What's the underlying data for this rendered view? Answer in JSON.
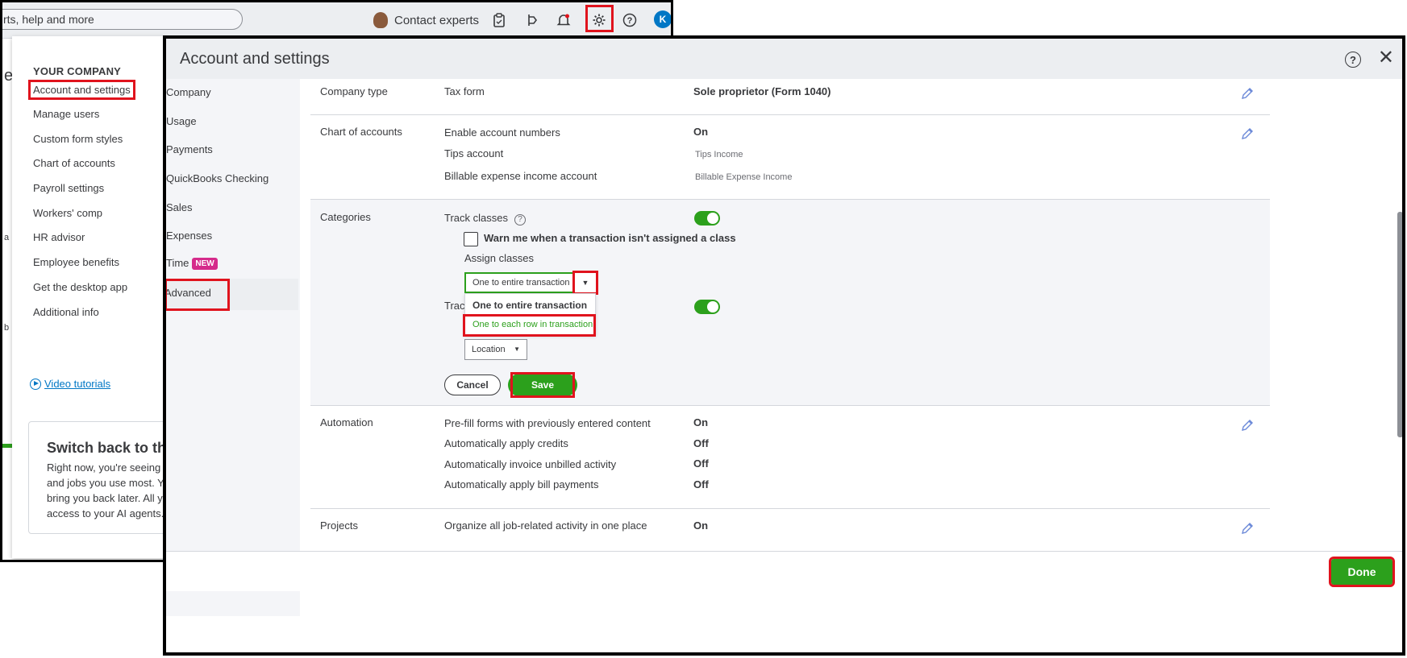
{
  "topbar": {
    "search_text": "rts, help and more",
    "contact_label": "Contact experts",
    "avatar_initial": "K"
  },
  "gear_panel": {
    "heading": "YOUR COMPANY",
    "links": [
      "Account and settings",
      "Manage users",
      "Custom form styles",
      "Chart of accounts",
      "Payroll settings",
      "Workers' comp",
      "HR advisor",
      "Employee benefits",
      "Get the desktop app",
      "Additional info"
    ],
    "video_link": "Video tutorials",
    "switch_title": "Switch back to th",
    "switch_text": [
      "Right now, you're seeing t",
      "and jobs you use most. Yo",
      "bring you back later. All y",
      "access to your AI agents."
    ]
  },
  "dialog": {
    "title": "Account and settings",
    "done_label": "Done"
  },
  "nav": {
    "items": [
      "Company",
      "Usage",
      "Payments",
      "QuickBooks Checking",
      "Sales",
      "Expenses",
      "Time",
      "Advanced"
    ],
    "time_badge": "NEW"
  },
  "sections": {
    "company_type": {
      "label": "Company type",
      "field": "Tax form",
      "value": "Sole proprietor (Form 1040)"
    },
    "chart_of_accounts": {
      "label": "Chart of accounts",
      "rows": [
        {
          "field": "Enable account numbers",
          "value": "On"
        },
        {
          "field": "Tips account",
          "value": "Tips Income"
        },
        {
          "field": "Billable expense income account",
          "value": "Billable Expense Income"
        }
      ]
    },
    "categories": {
      "label": "Categories",
      "track_classes": "Track classes",
      "warn_label": "Warn me when a transaction isn't assigned a class",
      "assign_label": "Assign classes",
      "assign_selected": "One to entire transaction",
      "dropdown_options": [
        "One to entire transaction",
        "One to each row in transaction"
      ],
      "track_locations_partial": "Track",
      "location_selected": "Location",
      "cancel_label": "Cancel",
      "save_label": "Save"
    },
    "automation": {
      "label": "Automation",
      "rows": [
        {
          "field": "Pre-fill forms with previously entered content",
          "value": "On"
        },
        {
          "field": "Automatically apply credits",
          "value": "Off"
        },
        {
          "field": "Automatically invoice unbilled activity",
          "value": "Off"
        },
        {
          "field": "Automatically apply bill payments",
          "value": "Off"
        }
      ]
    },
    "projects": {
      "label": "Projects",
      "field": "Organize all job-related activity in one place",
      "value": "On"
    }
  },
  "colors": {
    "brand_green": "#2ca01c",
    "highlight_red": "#e0131d",
    "link_blue": "#0077c5"
  }
}
